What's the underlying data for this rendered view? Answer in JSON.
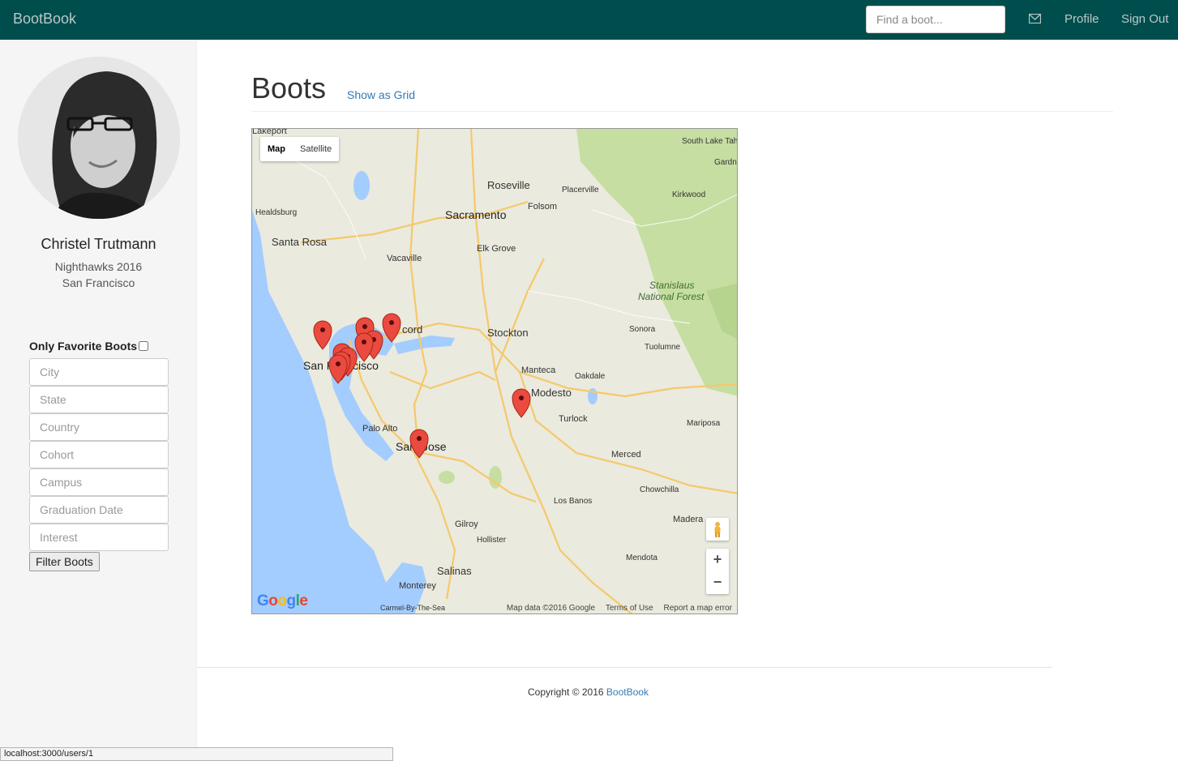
{
  "navbar": {
    "brand": "BootBook",
    "search_placeholder": "Find a boot...",
    "mail_icon": "envelope-icon",
    "profile": "Profile",
    "sign_out": "Sign Out"
  },
  "sidebar": {
    "avatar_icon": "user-avatar-photo",
    "name": "Christel Trutmann",
    "cohort": "Nighthawks 2016",
    "campus": "San Francisco",
    "favorites_label": "Only Favorite Boots",
    "filters": [
      {
        "placeholder": "City"
      },
      {
        "placeholder": "State"
      },
      {
        "placeholder": "Country"
      },
      {
        "placeholder": "Cohort"
      },
      {
        "placeholder": "Campus"
      },
      {
        "placeholder": "Graduation Date"
      },
      {
        "placeholder": "Interest"
      }
    ],
    "filter_button": "Filter Boots"
  },
  "main": {
    "title": "Boots",
    "show_grid": "Show as Grid"
  },
  "map": {
    "type_map": "Map",
    "type_satellite": "Satellite",
    "zoom_in": "+",
    "zoom_out": "−",
    "logo": "Google",
    "attrib_data": "Map data ©2016 Google",
    "attrib_terms": "Terms of Use",
    "attrib_report": "Report a map error",
    "labels": {
      "lakeport": "Lakeport",
      "south_lake_tahoe": "South Lake Tahoe",
      "gardn": "Gardn",
      "roseville": "Roseville",
      "placerville": "Placerville",
      "kirkwood": "Kirkwood",
      "folsom": "Folsom",
      "healdsburg": "Healdsburg",
      "sacramento": "Sacramento",
      "santa_rosa": "Santa Rosa",
      "elk_grove": "Elk Grove",
      "vacaville": "Vacaville",
      "stanislaus": "Stanislaus",
      "national_forest": "National Forest",
      "concord": "cord",
      "stockton": "Stockton",
      "sonora": "Sonora",
      "tuolumne": "Tuolumne",
      "san_francisco_a": "San F",
      "san_francisco_b": "cisco",
      "manteca": "Manteca",
      "oakdale": "Oakdale",
      "modesto": "Modesto",
      "turlock": "Turlock",
      "mariposa": "Mariposa",
      "palo_alto": "Palo Alto",
      "san_jose_a": "San",
      "san_jose_b": "Jose",
      "merced": "Merced",
      "chowchilla": "Chowchilla",
      "los_banos": "Los Banos",
      "madera": "Madera",
      "gilroy": "Gilroy",
      "hollister": "Hollister",
      "mendota": "Mendota",
      "salinas": "Salinas",
      "monterey": "Monterey",
      "carmel": "Carmel-By-The-Sea"
    }
  },
  "footer": {
    "copyright": "Copyright © 2016",
    "brand_link": "BootBook"
  },
  "status_bar": "localhost:3000/users/1"
}
